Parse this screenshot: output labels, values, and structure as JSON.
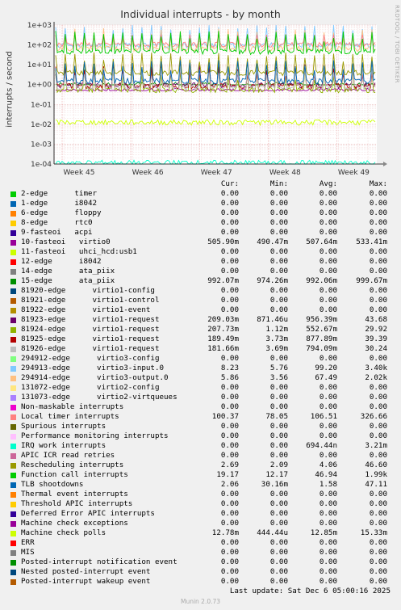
{
  "chart_data": {
    "type": "line",
    "title": "Individual interrupts - by month",
    "ylabel": "interrupts / second",
    "yscale": "log",
    "ylim": [
      0.0001,
      1000
    ],
    "yticks": [
      "1e+03",
      "1e+02",
      "1e+01",
      "1e+00",
      "1e-01",
      "1e-02",
      "1e-03",
      "1e-04"
    ],
    "xticks": [
      "Week 45",
      "Week 46",
      "Week 47",
      "Week 48",
      "Week 49"
    ],
    "grid": true,
    "side_label": "RRDTOOL / TOBI OETIKER",
    "headers": [
      "Cur:",
      "Min:",
      "Avg:",
      "Max:"
    ],
    "series": [
      {
        "name": "2-edge      timer",
        "color": "#00cc00",
        "cur": "0.00",
        "min": "0.00",
        "avg": "0.00",
        "max": "0.00"
      },
      {
        "name": "1-edge      i8042",
        "color": "#0066b3",
        "cur": "0.00",
        "min": "0.00",
        "avg": "0.00",
        "max": "0.00"
      },
      {
        "name": "6-edge      floppy",
        "color": "#ff8000",
        "cur": "0.00",
        "min": "0.00",
        "avg": "0.00",
        "max": "0.00"
      },
      {
        "name": "8-edge      rtc0",
        "color": "#ffcc00",
        "cur": "0.00",
        "min": "0.00",
        "avg": "0.00",
        "max": "0.00"
      },
      {
        "name": "9-fasteoi   acpi",
        "color": "#330099",
        "cur": "0.00",
        "min": "0.00",
        "avg": "0.00",
        "max": "0.00"
      },
      {
        "name": "10-fasteoi   virtio0",
        "color": "#990099",
        "cur": "505.90m",
        "min": "490.47m",
        "avg": "507.64m",
        "max": "533.41m"
      },
      {
        "name": "11-fasteoi   uhci_hcd:usb1",
        "color": "#ccff00",
        "cur": "0.00",
        "min": "0.00",
        "avg": "0.00",
        "max": "0.00"
      },
      {
        "name": "12-edge      i8042",
        "color": "#ff0000",
        "cur": "0.00",
        "min": "0.00",
        "avg": "0.00",
        "max": "0.00"
      },
      {
        "name": "14-edge      ata_piix",
        "color": "#808080",
        "cur": "0.00",
        "min": "0.00",
        "avg": "0.00",
        "max": "0.00"
      },
      {
        "name": "15-edge      ata_piix",
        "color": "#008f00",
        "cur": "992.07m",
        "min": "974.26m",
        "avg": "992.06m",
        "max": "999.67m"
      },
      {
        "name": "81920-edge      virtio1-config",
        "color": "#00487d",
        "cur": "0.00",
        "min": "0.00",
        "avg": "0.00",
        "max": "0.00"
      },
      {
        "name": "81921-edge      virtio1-control",
        "color": "#b35a00",
        "cur": "0.00",
        "min": "0.00",
        "avg": "0.00",
        "max": "0.00"
      },
      {
        "name": "81922-edge      virtio1-event",
        "color": "#b38f00",
        "cur": "0.00",
        "min": "0.00",
        "avg": "0.00",
        "max": "0.00"
      },
      {
        "name": "81923-edge      virtio1-request",
        "color": "#6b006b",
        "cur": "209.03m",
        "min": "871.46u",
        "avg": "956.39m",
        "max": "43.68"
      },
      {
        "name": "81924-edge      virtio1-request",
        "color": "#8fb300",
        "cur": "207.73m",
        "min": "1.12m",
        "avg": "552.67m",
        "max": "29.92"
      },
      {
        "name": "81925-edge      virtio1-request",
        "color": "#b30000",
        "cur": "189.49m",
        "min": "3.73m",
        "avg": "877.89m",
        "max": "39.39"
      },
      {
        "name": "81926-edge      virtio1-request",
        "color": "#bebebe",
        "cur": "181.66m",
        "min": "3.69m",
        "avg": "794.09m",
        "max": "30.24"
      },
      {
        "name": "294912-edge      virtio3-config",
        "color": "#80ff80",
        "cur": "0.00",
        "min": "0.00",
        "avg": "0.00",
        "max": "0.00"
      },
      {
        "name": "294913-edge      virtio3-input.0",
        "color": "#80c9ff",
        "cur": "8.23",
        "min": "5.76",
        "avg": "99.20",
        "max": "3.40k"
      },
      {
        "name": "294914-edge      virtio3-output.0",
        "color": "#ffc080",
        "cur": "5.86",
        "min": "3.56",
        "avg": "67.49",
        "max": "2.02k"
      },
      {
        "name": "131072-edge      virtio2-config",
        "color": "#ffe680",
        "cur": "0.00",
        "min": "0.00",
        "avg": "0.00",
        "max": "0.00"
      },
      {
        "name": "131073-edge      virtio2-virtqueues",
        "color": "#aa80ff",
        "cur": "0.00",
        "min": "0.00",
        "avg": "0.00",
        "max": "0.00"
      },
      {
        "name": "Non-maskable interrupts",
        "color": "#ee00cc",
        "cur": "0.00",
        "min": "0.00",
        "avg": "0.00",
        "max": "0.00"
      },
      {
        "name": "Local timer interrupts",
        "color": "#ff8080",
        "cur": "100.37",
        "min": "78.05",
        "avg": "106.51",
        "max": "326.66"
      },
      {
        "name": "Spurious interrupts",
        "color": "#666600",
        "cur": "0.00",
        "min": "0.00",
        "avg": "0.00",
        "max": "0.00"
      },
      {
        "name": "Performance monitoring interrupts",
        "color": "#ffbfff",
        "cur": "0.00",
        "min": "0.00",
        "avg": "0.00",
        "max": "0.00"
      },
      {
        "name": "IRQ work interrupts",
        "color": "#00ffcc",
        "cur": "0.00",
        "min": "0.00",
        "avg": "694.44n",
        "max": "3.21m"
      },
      {
        "name": "APIC ICR read retries",
        "color": "#cc6699",
        "cur": "0.00",
        "min": "0.00",
        "avg": "0.00",
        "max": "0.00"
      },
      {
        "name": "Rescheduling interrupts",
        "color": "#999900",
        "cur": "2.69",
        "min": "2.09",
        "avg": "4.06",
        "max": "46.60"
      },
      {
        "name": "Function call interrupts",
        "color": "#00cc00",
        "cur": "19.17",
        "min": "12.17",
        "avg": "46.94",
        "max": "1.99k"
      },
      {
        "name": "TLB shootdowns",
        "color": "#0066b3",
        "cur": "2.06",
        "min": "30.16m",
        "avg": "1.58",
        "max": "47.11"
      },
      {
        "name": "Thermal event interrupts",
        "color": "#ff8000",
        "cur": "0.00",
        "min": "0.00",
        "avg": "0.00",
        "max": "0.00"
      },
      {
        "name": "Threshold APIC interrupts",
        "color": "#ffcc00",
        "cur": "0.00",
        "min": "0.00",
        "avg": "0.00",
        "max": "0.00"
      },
      {
        "name": "Deferred Error APIC interrupts",
        "color": "#330099",
        "cur": "0.00",
        "min": "0.00",
        "avg": "0.00",
        "max": "0.00"
      },
      {
        "name": "Machine check exceptions",
        "color": "#990099",
        "cur": "0.00",
        "min": "0.00",
        "avg": "0.00",
        "max": "0.00"
      },
      {
        "name": "Machine check polls",
        "color": "#ccff00",
        "cur": "12.78m",
        "min": "444.44u",
        "avg": "12.85m",
        "max": "15.33m"
      },
      {
        "name": "ERR",
        "color": "#ff0000",
        "cur": "0.00",
        "min": "0.00",
        "avg": "0.00",
        "max": "0.00"
      },
      {
        "name": "MIS",
        "color": "#808080",
        "cur": "0.00",
        "min": "0.00",
        "avg": "0.00",
        "max": "0.00"
      },
      {
        "name": "Posted-interrupt notification event",
        "color": "#008f00",
        "cur": "0.00",
        "min": "0.00",
        "avg": "0.00",
        "max": "0.00"
      },
      {
        "name": "Nested posted-interrupt event",
        "color": "#00487d",
        "cur": "0.00",
        "min": "0.00",
        "avg": "0.00",
        "max": "0.00"
      },
      {
        "name": "Posted-interrupt wakeup event",
        "color": "#b35a00",
        "cur": "0.00",
        "min": "0.00",
        "avg": "0.00",
        "max": "0.00"
      }
    ]
  },
  "footer": {
    "last_update": "Last update: Sat Dec  6 05:00:16 2025",
    "munin": "Munin 2.0.73"
  }
}
